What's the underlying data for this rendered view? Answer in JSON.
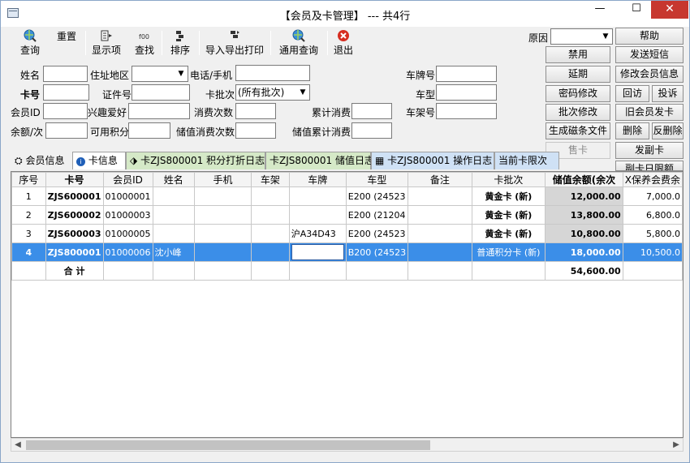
{
  "window": {
    "title": "【会员及卡管理】 --- 共4行",
    "minimize": "—",
    "maximize": "☐",
    "close": "✕"
  },
  "toolbar": {
    "query": "查询",
    "reset": "重置",
    "display": "显示项",
    "find": "查找",
    "sort": "排序",
    "import_export": "导入导出打印",
    "general_query": "通用查询",
    "exit": "退出"
  },
  "side": {
    "reason_label": "原因",
    "reason_value": "",
    "help": "帮助",
    "disable": "禁用",
    "send_sms": "发送短信",
    "extend": "延期",
    "edit_member": "修改会员信息",
    "pwd_change": "密码修改",
    "visit": "回访",
    "complaint": "投诉",
    "batch_change": "批次修改",
    "old_member_card": "旧会员发卡",
    "gen_mag_file": "生成磁条文件",
    "delete": "删除",
    "undelete": "反删除",
    "sell_card": "售卡",
    "issue_sub_card": "发副卡",
    "sub_card_limit": "副卡日限额"
  },
  "form": {
    "name": "姓名",
    "region": "住址地区",
    "phone": "电话/手机",
    "plate": "车牌号",
    "card_no": "卡号",
    "id_no": "证件号",
    "batch": "卡批次",
    "batch_value": "(所有批次)",
    "car_model": "车型",
    "member_id": "会员ID",
    "hobby": "兴趣爱好",
    "consume_count": "消费次数",
    "total_consume": "累计消费",
    "frame_no": "车架号",
    "balance_times": "余额/次",
    "points": "可用积分",
    "stored_consume_count": "储值消费次数",
    "stored_total_consume": "储值累计消费"
  },
  "tabs": [
    {
      "label": "会员信息"
    },
    {
      "label": "卡信息"
    },
    {
      "label": "卡ZJS800001 积分打折日志"
    },
    {
      "label": "卡ZJS800001 储值日志"
    },
    {
      "label": "卡ZJS800001 操作日志"
    },
    {
      "label": "当前卡限次"
    }
  ],
  "table": {
    "headers": [
      "序号",
      "卡号",
      "会员ID",
      "姓名",
      "手机",
      "车架",
      "车牌",
      "车型",
      "备注",
      "卡批次",
      "储值余额(余次",
      "X保养会费余"
    ],
    "rows": [
      {
        "seq": "1",
        "card": "ZJS600001",
        "member_id": "01000001",
        "name": "",
        "phone": "",
        "frame": "",
        "plate": "",
        "model": "E200 (24523",
        "note": "",
        "batch": "黄金卡 (新)",
        "balance": "12,000.00",
        "fee": "7,000.0"
      },
      {
        "seq": "2",
        "card": "ZJS600002",
        "member_id": "01000003",
        "name": "",
        "phone": "",
        "frame": "",
        "plate": "",
        "model": "E200 (21204",
        "note": "",
        "batch": "黄金卡 (新)",
        "balance": "13,800.00",
        "fee": "6,800.0"
      },
      {
        "seq": "3",
        "card": "ZJS600003",
        "member_id": "01000005",
        "name": "",
        "phone": "",
        "frame": "",
        "plate": "沪A34D43",
        "model": "E200 (24523",
        "note": "",
        "batch": "黄金卡 (新)",
        "balance": "10,800.00",
        "fee": "5,800.0"
      },
      {
        "seq": "4",
        "card": "ZJS800001",
        "member_id": "01000006",
        "name": "沈小峰",
        "phone": "",
        "frame": "",
        "plate": "",
        "model": "B200 (24523",
        "note": "",
        "batch": "普通积分卡 (新)",
        "balance": "18,000.00",
        "fee": "10,500.0"
      }
    ],
    "total_label": "合 计",
    "total_balance": "54,600.00"
  },
  "colors": {
    "selection": "#3b8ee8",
    "close_button": "#c7372f",
    "highlight_column": "#d6d6d6"
  }
}
